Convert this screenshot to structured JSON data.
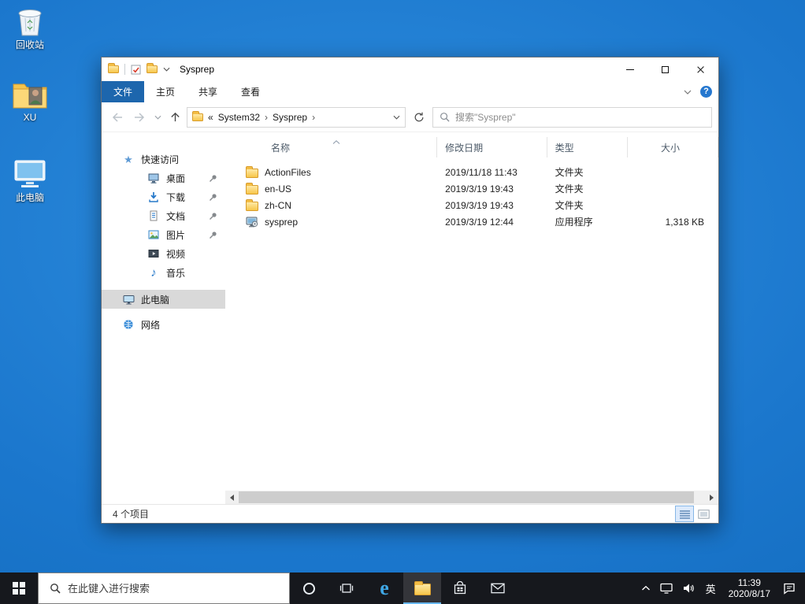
{
  "desktop": {
    "icons": [
      {
        "label": "回收站"
      },
      {
        "label": "XU"
      },
      {
        "label": "此电脑"
      }
    ]
  },
  "window": {
    "title": "Sysprep",
    "tabs": [
      {
        "label": "文件"
      },
      {
        "label": "主页"
      },
      {
        "label": "共享"
      },
      {
        "label": "查看"
      }
    ],
    "address": {
      "overflow": "«",
      "separator": "›",
      "crumbs": [
        "System32",
        "Sysprep"
      ],
      "search_placeholder": "搜索\"Sysprep\""
    },
    "sidebar": {
      "quick_access": "快速访问",
      "items": [
        {
          "label": "桌面"
        },
        {
          "label": "下载"
        },
        {
          "label": "文档"
        },
        {
          "label": "图片"
        },
        {
          "label": "视频"
        },
        {
          "label": "音乐"
        }
      ],
      "this_pc": "此电脑",
      "network": "网络"
    },
    "list": {
      "columns": [
        "名称",
        "修改日期",
        "类型",
        "大小"
      ],
      "rows": [
        {
          "name": "ActionFiles",
          "date": "2019/11/18 11:43",
          "type": "文件夹",
          "size": ""
        },
        {
          "name": "en-US",
          "date": "2019/3/19 19:43",
          "type": "文件夹",
          "size": ""
        },
        {
          "name": "zh-CN",
          "date": "2019/3/19 19:43",
          "type": "文件夹",
          "size": ""
        },
        {
          "name": "sysprep",
          "date": "2019/3/19 12:44",
          "type": "应用程序",
          "size": "1,318 KB"
        }
      ]
    },
    "status": "4 个项目"
  },
  "taskbar": {
    "search_placeholder": "在此键入进行搜索",
    "tray": {
      "ime": "英",
      "time": "11:39",
      "date": "2020/8/17"
    }
  },
  "icons": {
    "help": "?",
    "star": "★",
    "music_note": "♪",
    "edge_e": "e"
  },
  "colors": {
    "accent_tab": "#1d66ad",
    "taskbar": "#16181d",
    "sidebar_selection": "#d9d9d9",
    "folder_yellow": "#f7c64a",
    "desktop_blue": "#1b77cd"
  }
}
